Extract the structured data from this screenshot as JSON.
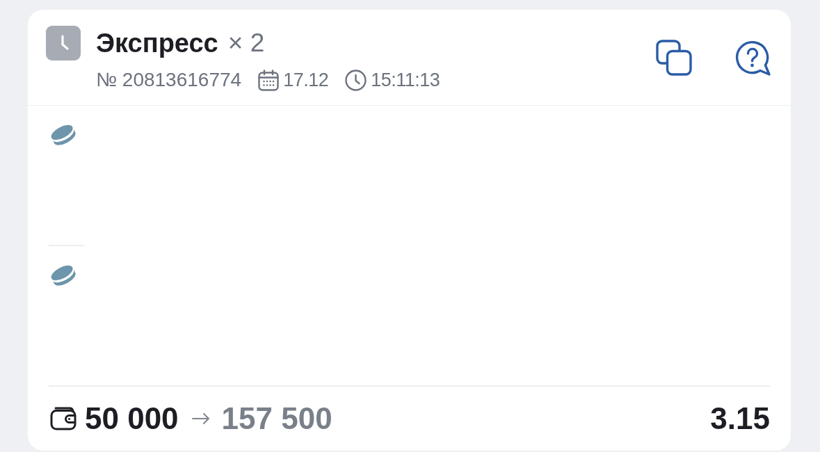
{
  "bet": {
    "title": "Экспресс",
    "count": "× 2",
    "number": "№ 20813616774",
    "date": "17.12",
    "time": "15:11:13"
  },
  "events": [
    {
      "kind": "hockey"
    },
    {
      "kind": "hockey"
    }
  ],
  "footer": {
    "stake": "50 000",
    "payout": "157 500",
    "odds": "3.15"
  }
}
